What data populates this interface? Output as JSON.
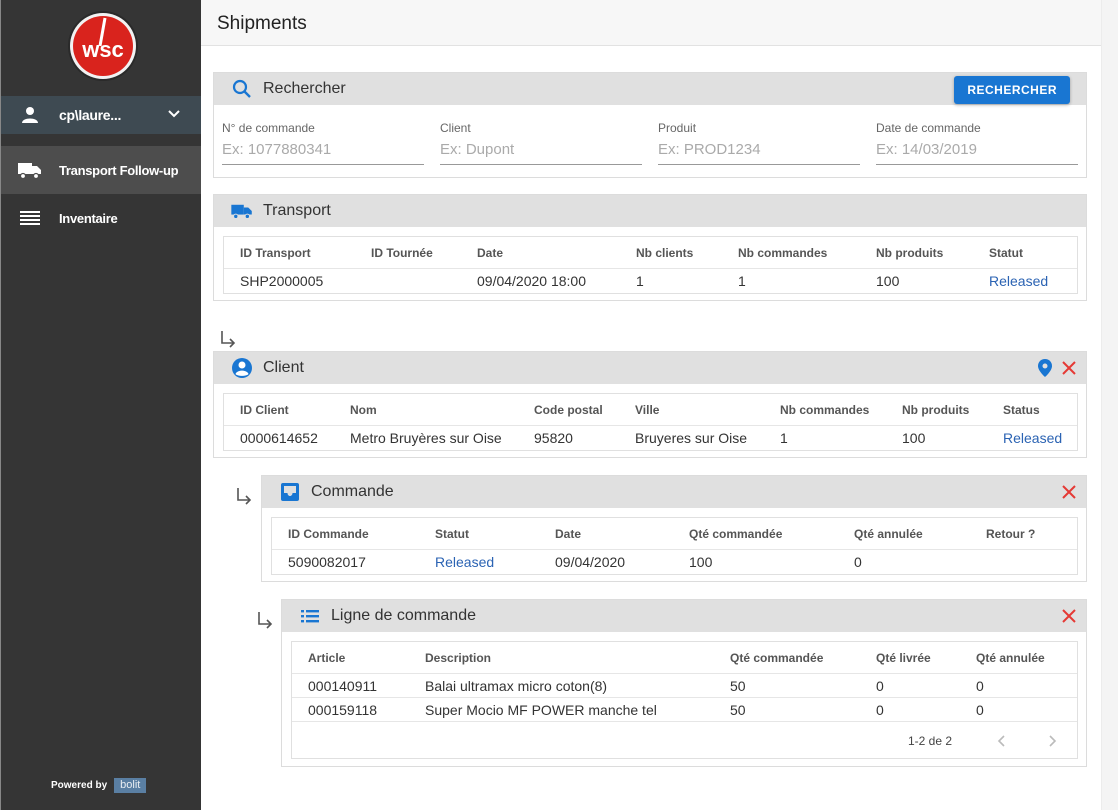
{
  "brand": {
    "logo_text": "wsc",
    "colors": {
      "sidebar": "#353535",
      "accent": "#1976d2",
      "danger": "#e53935",
      "logo_red": "#d9231d"
    }
  },
  "sidebar": {
    "user": {
      "name": "cp\\laure...",
      "icon": "person-icon",
      "chevron": "chevron-down-icon"
    },
    "items": [
      {
        "label": "Transport Follow-up",
        "icon": "truck-icon",
        "active": true
      },
      {
        "label": "Inventaire",
        "icon": "list-icon",
        "active": false
      }
    ],
    "powered_by": "Powered by",
    "powered_brand": "bolit"
  },
  "header": {
    "title": "Shipments"
  },
  "search": {
    "title": "Rechercher",
    "button": "RECHERCHER",
    "fields": [
      {
        "label": "N° de commande",
        "placeholder": "Ex: 1077880341"
      },
      {
        "label": "Client",
        "placeholder": "Ex: Dupont"
      },
      {
        "label": "Produit",
        "placeholder": "Ex: PROD1234"
      },
      {
        "label": "Date de commande",
        "placeholder": "Ex: 14/03/2019"
      }
    ]
  },
  "transport": {
    "title": "Transport",
    "columns": [
      "ID Transport",
      "ID Tournée",
      "Date",
      "Nb clients",
      "Nb commandes",
      "Nb produits",
      "Statut"
    ],
    "rows": [
      [
        "SHP2000005",
        "",
        "09/04/2020 18:00",
        "1",
        "1",
        "100",
        "Released"
      ]
    ]
  },
  "client": {
    "title": "Client",
    "columns": [
      "ID Client",
      "Nom",
      "Code postal",
      "Ville",
      "Nb commandes",
      "Nb produits",
      "Status"
    ],
    "rows": [
      [
        "0000614652",
        "Metro Bruyères sur Oise",
        "95820",
        "Bruyeres sur Oise",
        "1",
        "100",
        "Released"
      ]
    ]
  },
  "commande": {
    "title": "Commande",
    "columns": [
      "ID Commande",
      "Statut",
      "Date",
      "Qté commandée",
      "Qté annulée",
      "Retour ?"
    ],
    "rows": [
      [
        "5090082017",
        "Released",
        "09/04/2020",
        "100",
        "0",
        ""
      ]
    ]
  },
  "ligne": {
    "title": "Ligne de commande",
    "columns": [
      "Article",
      "Description",
      "Qté commandée",
      "Qté livrée",
      "Qté annulée"
    ],
    "rows": [
      [
        "000140911",
        "Balai ultramax micro coton(8)",
        "50",
        "0",
        "0"
      ],
      [
        "000159118",
        "Super Mocio MF POWER manche tel",
        "50",
        "0",
        "0"
      ]
    ],
    "pagination": "1-2 de 2"
  }
}
